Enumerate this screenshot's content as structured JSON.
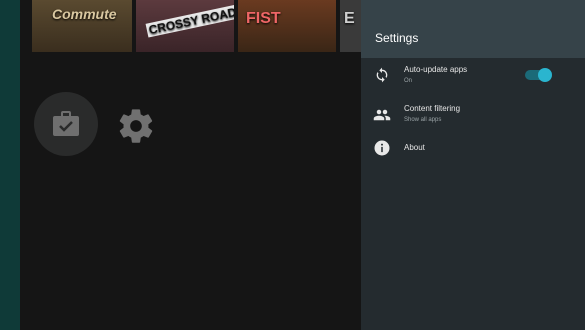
{
  "background": {
    "tiles": [
      {
        "name": "Commute",
        "color": "#4a3c28"
      },
      {
        "name": "CROSSY ROAD",
        "color": "#4a2e32"
      },
      {
        "name": "FIST",
        "color": "#522e1a"
      },
      {
        "name": "E",
        "color": "#3a3a3a"
      }
    ],
    "apps_icon": "briefcase-check-icon",
    "settings_icon": "gear-icon"
  },
  "settings": {
    "title": "Settings",
    "items": [
      {
        "label": "Auto-update apps",
        "sublabel": "On",
        "icon": "sync-icon",
        "toggle": true
      },
      {
        "label": "Content filtering",
        "sublabel": "Show all apps",
        "icon": "people-icon"
      },
      {
        "label": "About",
        "sublabel": "",
        "icon": "info-icon"
      }
    ]
  },
  "colors": {
    "panel_bg": "#242b2f",
    "header_bg": "#364349",
    "accent": "#2ab5cf",
    "left_strip": "#0f3a38"
  }
}
